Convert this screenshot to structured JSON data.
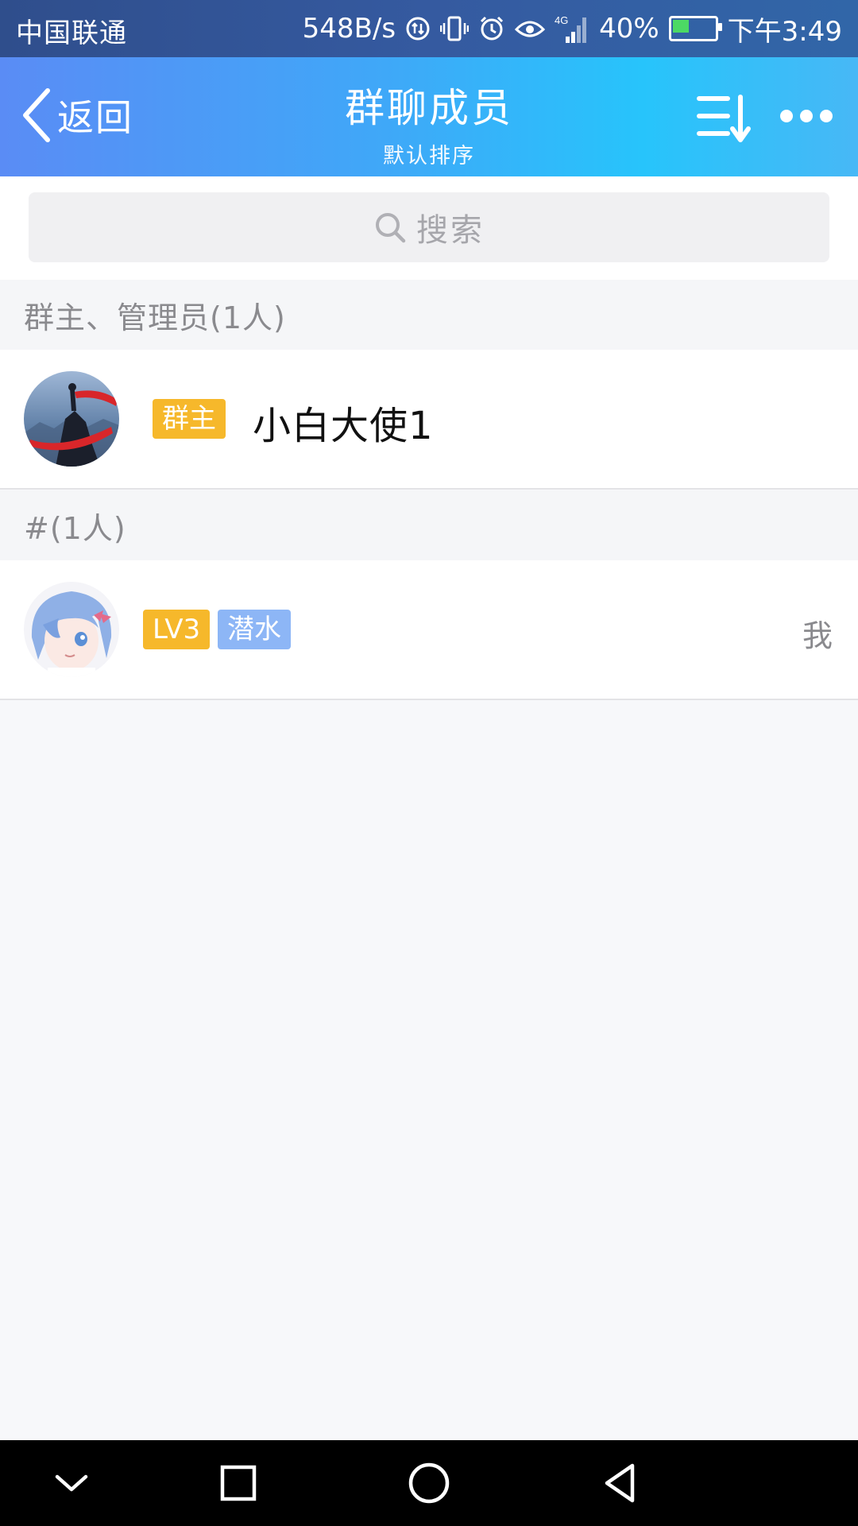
{
  "status_bar": {
    "carrier": "中国联通",
    "net_speed": "548B/s",
    "signal_label": "4G",
    "battery_pct": "40%",
    "time": "下午3:49",
    "icons": [
      "data-icon",
      "vibrate-icon",
      "alarm-icon",
      "eye-icon",
      "signal-icon",
      "battery-icon"
    ]
  },
  "nav": {
    "back_label": "返回",
    "title": "群聊成员",
    "subtitle": "默认排序",
    "sort_icon": "sort-icon",
    "more_icon": "more-icon"
  },
  "search": {
    "placeholder": "搜索",
    "icon": "search-icon"
  },
  "sections": [
    {
      "header": "群主、管理员(1人)",
      "members": [
        {
          "tags": [
            "群主"
          ],
          "name": "小白大使1",
          "right_label": ""
        }
      ]
    },
    {
      "header": "#(1人)",
      "members": [
        {
          "tags": [
            "LV3",
            "潜水"
          ],
          "name": "",
          "right_label": "我"
        }
      ]
    }
  ],
  "colors": {
    "nav_gradient_start": "#5a8cf5",
    "nav_gradient_end": "#27c4fb",
    "tag_owner": "#f6b82b",
    "tag_level": "#f6b82b",
    "tag_dive": "#8db6f6",
    "page_bg": "#f7f8fa"
  },
  "system_nav": {
    "icons": [
      "collapse-icon",
      "recents-icon",
      "home-icon",
      "back-triangle-icon"
    ]
  }
}
